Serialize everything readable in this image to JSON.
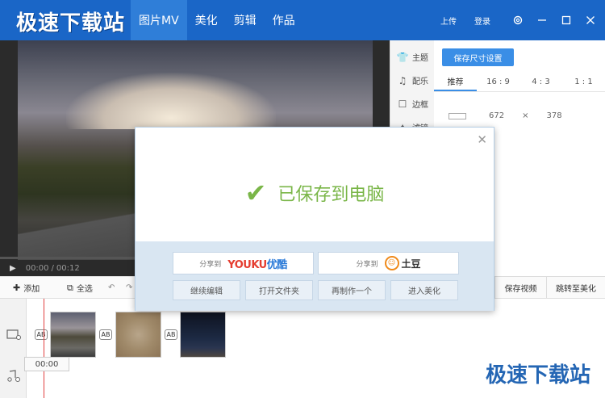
{
  "brand": "极速下载站",
  "nav": [
    {
      "label": "图片MV",
      "active": true
    },
    {
      "label": "美化",
      "active": false
    },
    {
      "label": "剪辑",
      "active": false
    },
    {
      "label": "作品",
      "active": false
    }
  ],
  "window": {
    "upload_label": "上传",
    "login_label": "登录",
    "settings_icon": "gear-icon",
    "minimize_icon": "minimize-icon",
    "maximize_icon": "maximize-icon",
    "close_icon": "close-icon"
  },
  "player": {
    "current_time": "00:00",
    "separator": "/",
    "total_time": "00:12",
    "progress": 0
  },
  "side_tabs": [
    {
      "label": "主题",
      "icon": "shirt-icon"
    },
    {
      "label": "配乐",
      "icon": "music-note-icon"
    },
    {
      "label": "边框",
      "icon": "frame-icon"
    },
    {
      "label": "滤镜",
      "icon": "filter-icon"
    }
  ],
  "panel": {
    "save_size_button": "保存尺寸设置",
    "ratio_tabs": [
      {
        "label": "推荐",
        "active": true
      },
      {
        "label": "16 : 9",
        "active": false
      },
      {
        "label": "4 : 3",
        "active": false
      },
      {
        "label": "1 : 1",
        "active": false
      }
    ],
    "width": "672",
    "times": "×",
    "height": "378"
  },
  "toolbar": {
    "add_label": "添加",
    "select_all_label": "全选",
    "save_video_label": "保存视频",
    "go_beautify_label": "跳转至美化"
  },
  "timeline": {
    "timecode": "00:00",
    "transition_label": "AB",
    "clips": [
      "road-mountain-thumb",
      "group-photo-thumb",
      "night-sky-thumb"
    ]
  },
  "dialog": {
    "message": "已保存到电脑",
    "share_prefix": "分享到",
    "youku_logo": "YOUKU",
    "youku_suffix": "优酷",
    "tudou_logo": "土豆",
    "actions": [
      "继续编辑",
      "打开文件夹",
      "再制作一个",
      "进入美化"
    ]
  },
  "watermark": "极速下载站",
  "colors": {
    "titlebar": "#1a66c7",
    "accent": "#3a8ee6",
    "success": "#7ab648",
    "dialog_footer": "#d9e6f2"
  }
}
